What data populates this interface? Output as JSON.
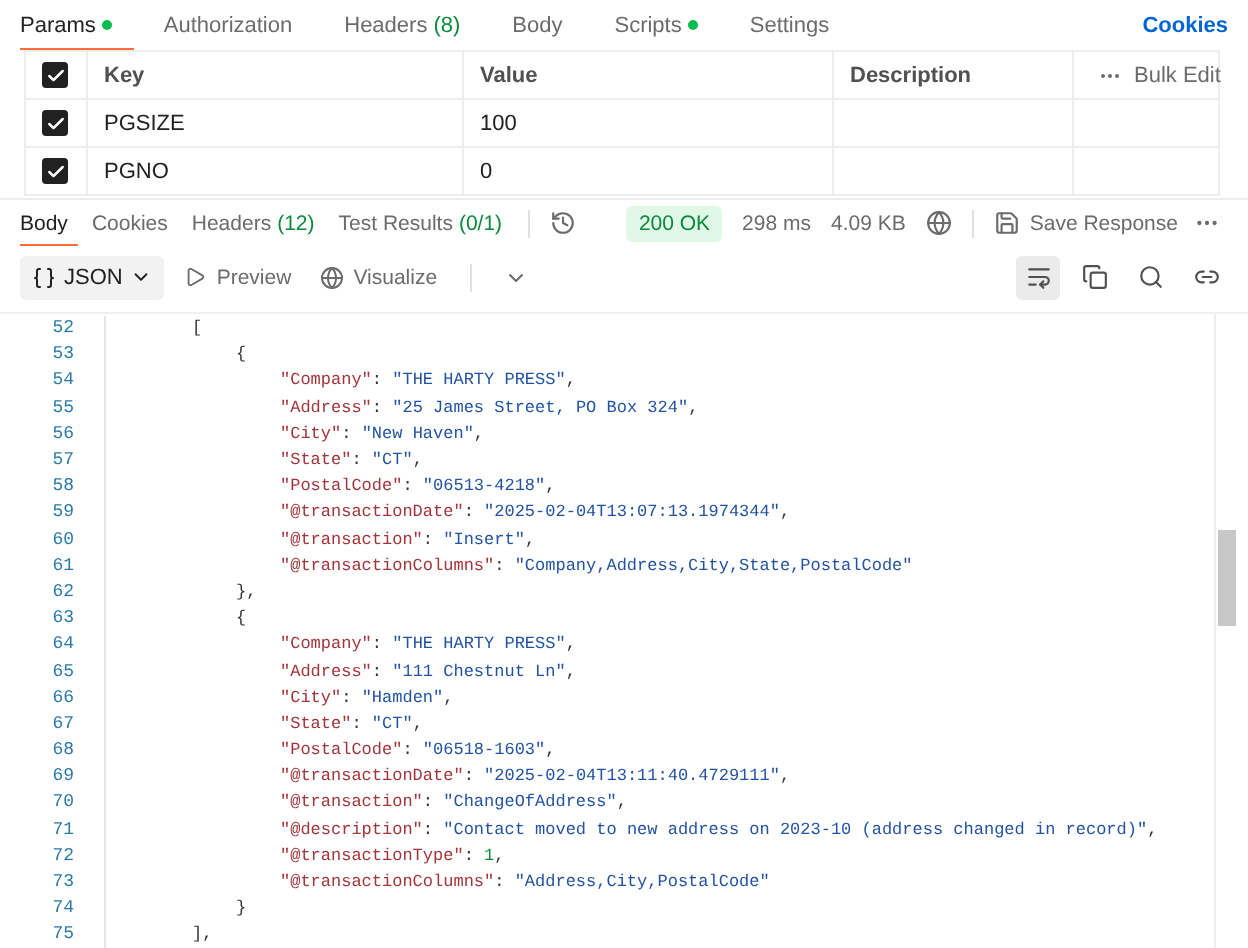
{
  "request_tabs": [
    {
      "label": "Params",
      "dot": true,
      "selected": true
    },
    {
      "label": "Authorization",
      "dot": false,
      "selected": false
    },
    {
      "label": "Headers",
      "count": "(8)",
      "dot": false,
      "selected": false
    },
    {
      "label": "Body",
      "dot": false,
      "selected": false
    },
    {
      "label": "Scripts",
      "dot": true,
      "selected": false
    },
    {
      "label": "Settings",
      "dot": false,
      "selected": false
    }
  ],
  "cookies_link": "Cookies",
  "params_table": {
    "all_checked": true,
    "columns": [
      "Key",
      "Value",
      "Description"
    ],
    "bulk_edit": "Bulk Edit",
    "rows": [
      {
        "checked": true,
        "key": "PGSIZE",
        "value": "100"
      },
      {
        "checked": true,
        "key": "PGNO",
        "value": "0"
      }
    ]
  },
  "response_tabs": [
    {
      "label": "Body",
      "selected": true
    },
    {
      "label": "Cookies",
      "selected": false
    },
    {
      "label": "Headers",
      "count": "(12)",
      "selected": false
    },
    {
      "label": "Test Results",
      "count": "(0/1)",
      "selected": false
    }
  ],
  "status": "200 OK",
  "time": "298 ms",
  "size": "4.09 KB",
  "save_response": "Save Response",
  "format_select": "JSON",
  "preview": "Preview",
  "visualize": "Visualize",
  "code_lines": [
    {
      "number": "52",
      "tokens": [
        {
          "kind": "punct",
          "text": "["
        }
      ]
    },
    {
      "number": "53",
      "tokens": [
        {
          "kind": "punct",
          "text": "{"
        }
      ]
    },
    {
      "number": "54",
      "tokens": [
        {
          "kind": "key",
          "text": "\"Company\""
        },
        {
          "kind": "punct",
          "text": ": "
        },
        {
          "kind": "string",
          "text": "\"THE HARTY PRESS\""
        },
        {
          "kind": "punct",
          "text": ","
        }
      ]
    },
    {
      "number": "55",
      "tokens": [
        {
          "kind": "key",
          "text": "\"Address\""
        },
        {
          "kind": "punct",
          "text": ": "
        },
        {
          "kind": "string",
          "text": "\"25 James Street, PO Box 324\""
        },
        {
          "kind": "punct",
          "text": ","
        }
      ]
    },
    {
      "number": "56",
      "tokens": [
        {
          "kind": "key",
          "text": "\"City\""
        },
        {
          "kind": "punct",
          "text": ": "
        },
        {
          "kind": "string",
          "text": "\"New Haven\""
        },
        {
          "kind": "punct",
          "text": ","
        }
      ]
    },
    {
      "number": "57",
      "tokens": [
        {
          "kind": "key",
          "text": "\"State\""
        },
        {
          "kind": "punct",
          "text": ": "
        },
        {
          "kind": "string",
          "text": "\"CT\""
        },
        {
          "kind": "punct",
          "text": ","
        }
      ]
    },
    {
      "number": "58",
      "tokens": [
        {
          "kind": "key",
          "text": "\"PostalCode\""
        },
        {
          "kind": "punct",
          "text": ": "
        },
        {
          "kind": "string",
          "text": "\"06513-4218\""
        },
        {
          "kind": "punct",
          "text": ","
        }
      ]
    },
    {
      "number": "59",
      "tokens": [
        {
          "kind": "key",
          "text": "\"@transactionDate\""
        },
        {
          "kind": "punct",
          "text": ": "
        },
        {
          "kind": "string",
          "text": "\"2025-02-04T13:07:13.1974344\""
        },
        {
          "kind": "punct",
          "text": ","
        }
      ]
    },
    {
      "number": "60",
      "tokens": [
        {
          "kind": "key",
          "text": "\"@transaction\""
        },
        {
          "kind": "punct",
          "text": ": "
        },
        {
          "kind": "string",
          "text": "\"Insert\""
        },
        {
          "kind": "punct",
          "text": ","
        }
      ]
    },
    {
      "number": "61",
      "tokens": [
        {
          "kind": "key",
          "text": "\"@transactionColumns\""
        },
        {
          "kind": "punct",
          "text": ": "
        },
        {
          "kind": "string",
          "text": "\"Company,Address,City,State,PostalCode\""
        }
      ]
    },
    {
      "number": "62",
      "tokens": [
        {
          "kind": "punct",
          "text": "},"
        }
      ]
    },
    {
      "number": "63",
      "tokens": [
        {
          "kind": "punct",
          "text": "{"
        }
      ]
    },
    {
      "number": "64",
      "tokens": [
        {
          "kind": "key",
          "text": "\"Company\""
        },
        {
          "kind": "punct",
          "text": ": "
        },
        {
          "kind": "string",
          "text": "\"THE HARTY PRESS\""
        },
        {
          "kind": "punct",
          "text": ","
        }
      ]
    },
    {
      "number": "65",
      "tokens": [
        {
          "kind": "key",
          "text": "\"Address\""
        },
        {
          "kind": "punct",
          "text": ": "
        },
        {
          "kind": "string",
          "text": "\"111 Chestnut Ln\""
        },
        {
          "kind": "punct",
          "text": ","
        }
      ]
    },
    {
      "number": "66",
      "tokens": [
        {
          "kind": "key",
          "text": "\"City\""
        },
        {
          "kind": "punct",
          "text": ": "
        },
        {
          "kind": "string",
          "text": "\"Hamden\""
        },
        {
          "kind": "punct",
          "text": ","
        }
      ]
    },
    {
      "number": "67",
      "tokens": [
        {
          "kind": "key",
          "text": "\"State\""
        },
        {
          "kind": "punct",
          "text": ": "
        },
        {
          "kind": "string",
          "text": "\"CT\""
        },
        {
          "kind": "punct",
          "text": ","
        }
      ]
    },
    {
      "number": "68",
      "tokens": [
        {
          "kind": "key",
          "text": "\"PostalCode\""
        },
        {
          "kind": "punct",
          "text": ": "
        },
        {
          "kind": "string",
          "text": "\"06518-1603\""
        },
        {
          "kind": "punct",
          "text": ","
        }
      ]
    },
    {
      "number": "69",
      "tokens": [
        {
          "kind": "key",
          "text": "\"@transactionDate\""
        },
        {
          "kind": "punct",
          "text": ": "
        },
        {
          "kind": "string",
          "text": "\"2025-02-04T13:11:40.4729111\""
        },
        {
          "kind": "punct",
          "text": ","
        }
      ]
    },
    {
      "number": "70",
      "tokens": [
        {
          "kind": "key",
          "text": "\"@transaction\""
        },
        {
          "kind": "punct",
          "text": ": "
        },
        {
          "kind": "string",
          "text": "\"ChangeOfAddress\""
        },
        {
          "kind": "punct",
          "text": ","
        }
      ]
    },
    {
      "number": "71",
      "tokens": [
        {
          "kind": "key",
          "text": "\"@description\""
        },
        {
          "kind": "punct",
          "text": ": "
        },
        {
          "kind": "string",
          "text": "\"Contact moved to new address on 2023-10 (address changed in record)\""
        },
        {
          "kind": "punct",
          "text": ","
        }
      ]
    },
    {
      "number": "72",
      "tokens": [
        {
          "kind": "key",
          "text": "\"@transactionType\""
        },
        {
          "kind": "punct",
          "text": ": "
        },
        {
          "kind": "number",
          "text": "1"
        },
        {
          "kind": "punct",
          "text": ","
        }
      ]
    },
    {
      "number": "73",
      "tokens": [
        {
          "kind": "key",
          "text": "\"@transactionColumns\""
        },
        {
          "kind": "punct",
          "text": ": "
        },
        {
          "kind": "string",
          "text": "\"Address,City,PostalCode\""
        }
      ]
    },
    {
      "number": "74",
      "tokens": [
        {
          "kind": "punct",
          "text": "}"
        }
      ]
    },
    {
      "number": "75",
      "tokens": [
        {
          "kind": "punct",
          "text": "],"
        }
      ]
    }
  ]
}
